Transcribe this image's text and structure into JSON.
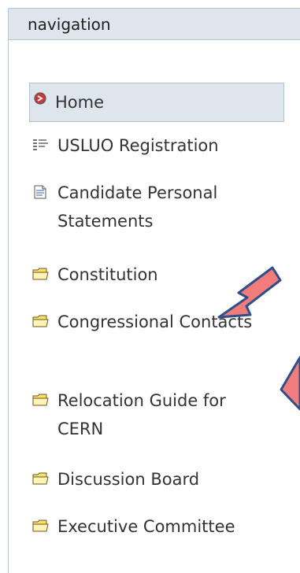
{
  "navigation": {
    "title": "navigation",
    "items": [
      {
        "label": "Home",
        "icon": "home-icon",
        "selected": true
      },
      {
        "label": "USLUO Registration",
        "icon": "form-icon",
        "selected": false
      },
      {
        "label": "Candidate Personal Statements",
        "icon": "document-icon",
        "selected": false
      },
      {
        "label": "Constitution",
        "icon": "folder-icon",
        "selected": false
      },
      {
        "label": "Congressional Contacts",
        "icon": "folder-icon",
        "selected": false
      },
      {
        "label": "Relocation Guide for CERN",
        "icon": "folder-icon",
        "selected": false
      },
      {
        "label": "Discussion Board",
        "icon": "folder-icon",
        "selected": false
      },
      {
        "label": "Executive Committee",
        "icon": "folder-icon",
        "selected": false
      }
    ]
  },
  "annotation": {
    "arrow_color": "#f07c7c",
    "arrow_outline": "#2f4f86"
  }
}
